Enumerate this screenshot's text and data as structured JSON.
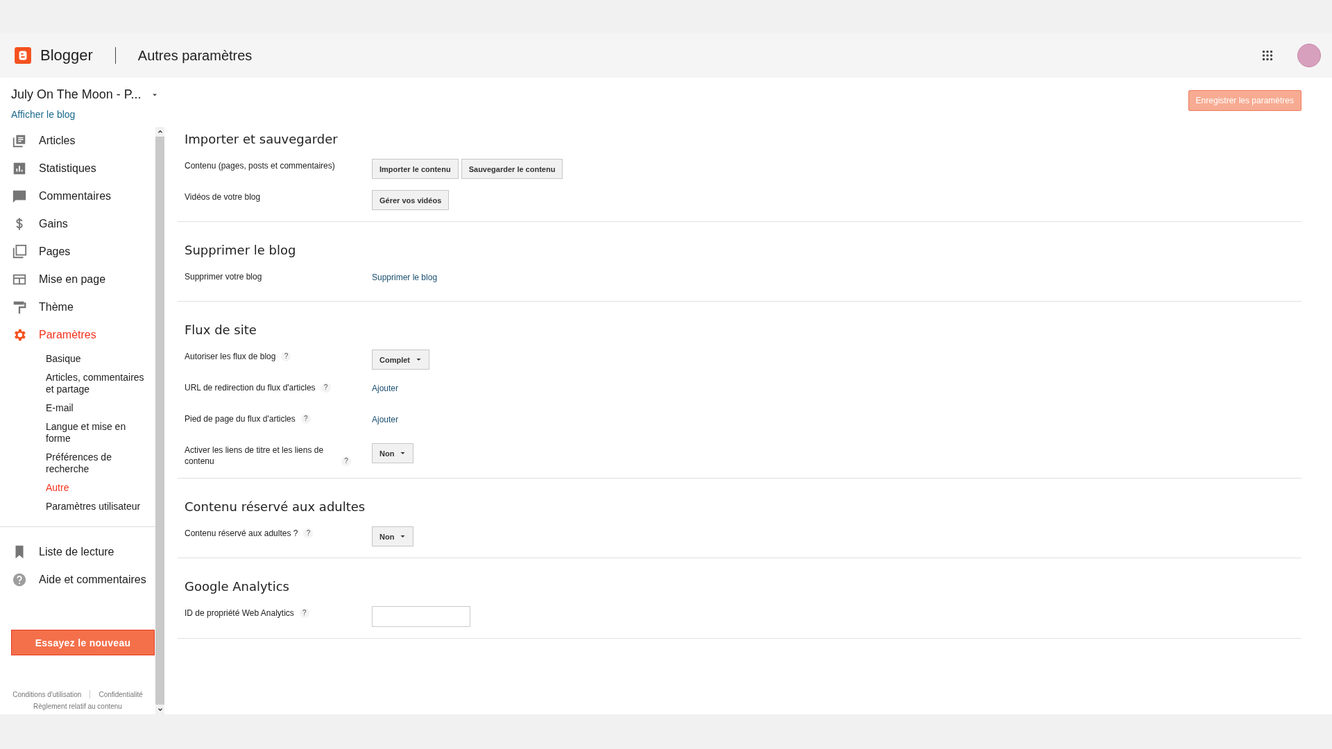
{
  "header": {
    "brand": "Blogger",
    "title": "Autres paramètres"
  },
  "blog_selector": {
    "name": "July On The Moon - P...",
    "view_link": "Afficher le blog"
  },
  "save_button": {
    "label": "Enregistrer les paramètres",
    "disabled": true
  },
  "sidebar": {
    "items": [
      {
        "label": "Articles",
        "kind": "articles",
        "selected": false
      },
      {
        "label": "Statistiques",
        "kind": "stats",
        "selected": false
      },
      {
        "label": "Commentaires",
        "kind": "comments",
        "selected": false
      },
      {
        "label": "Gains",
        "kind": "dollar",
        "selected": false
      },
      {
        "label": "Pages",
        "kind": "pages",
        "selected": false
      },
      {
        "label": "Mise en page",
        "kind": "layout",
        "selected": false
      },
      {
        "label": "Thème",
        "kind": "theme",
        "selected": false
      },
      {
        "label": "Paramètres",
        "kind": "gear",
        "selected": true,
        "children": [
          {
            "label": "Basique",
            "selected": false
          },
          {
            "label": "Articles, commentaires et partage",
            "selected": false
          },
          {
            "label": "E-mail",
            "selected": false
          },
          {
            "label": "Langue et mise en forme",
            "selected": false
          },
          {
            "label": "Préférences de recherche",
            "selected": false
          },
          {
            "label": "Autre",
            "selected": true
          },
          {
            "label": "Paramètres utilisateur",
            "selected": false
          }
        ]
      }
    ],
    "secondary_items": [
      {
        "label": "Liste de lecture",
        "kind": "bookmark"
      },
      {
        "label": "Aide et commentaires",
        "kind": "help"
      }
    ],
    "try_button": "Essayez le nouveau",
    "footer_links": [
      "Conditions d'utilisation",
      "Confidentialité",
      "Règlement relatif au contenu"
    ]
  },
  "sections": [
    {
      "title": "Importer et sauvegarder",
      "rows": [
        {
          "label": "Contenu (pages, posts et commentaires)",
          "kind": "buttons",
          "buttons": [
            "Importer le contenu",
            "Sauvegarder le contenu"
          ]
        },
        {
          "label": "Vidéos de votre blog",
          "kind": "buttons",
          "buttons": [
            "Gérer vos vidéos"
          ]
        }
      ]
    },
    {
      "title": "Supprimer le blog",
      "rows": [
        {
          "label": "Supprimer votre blog",
          "kind": "link",
          "link": "Supprimer le blog"
        }
      ]
    },
    {
      "title": "Flux de site",
      "rows": [
        {
          "label": "Autoriser les flux de blog",
          "help_mark": "?",
          "kind": "select",
          "value": "Complet"
        },
        {
          "label": "URL de redirection du flux d'articles",
          "help_mark": "?",
          "kind": "link",
          "link": "Ajouter"
        },
        {
          "label": "Pied de page du flux d'articles",
          "help_mark": "?",
          "kind": "link",
          "link": "Ajouter"
        },
        {
          "label": "Activer les liens de titre et les liens de contenu",
          "help_mark": "?",
          "kind": "select",
          "value": "Non"
        }
      ]
    },
    {
      "title": "Contenu réservé aux adultes",
      "rows": [
        {
          "label": "Contenu réservé aux adultes ?",
          "help_mark": "?",
          "kind": "select",
          "value": "Non"
        }
      ]
    },
    {
      "title": "Google Analytics",
      "rows": [
        {
          "label": "ID de propriété Web Analytics",
          "help_mark": "?",
          "kind": "input"
        }
      ]
    }
  ]
}
